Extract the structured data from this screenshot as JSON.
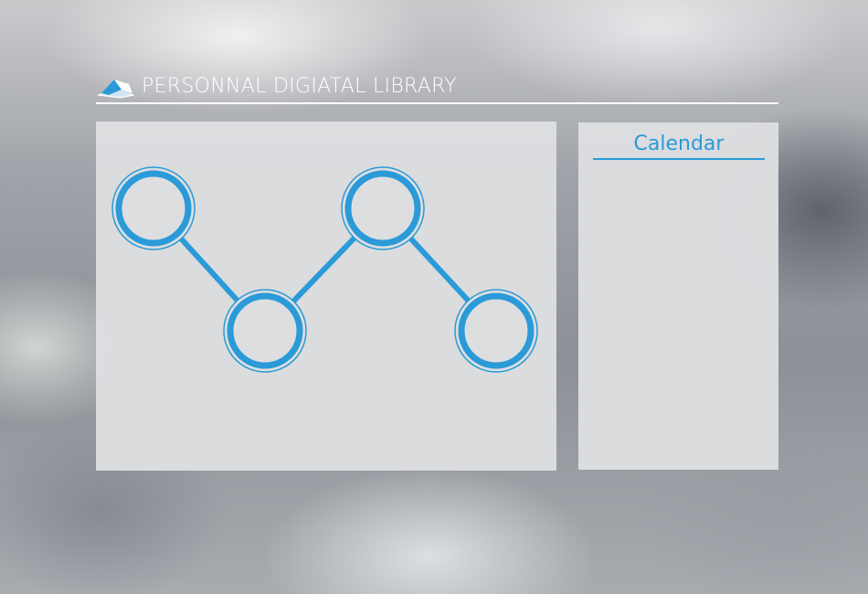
{
  "header": {
    "title": "PERSONNAL DIGIATAL LIBRARY",
    "logo_icon": "open-book-icon"
  },
  "calendar": {
    "title": "Calendar"
  },
  "theme": {
    "accent": "#2a9ad8",
    "panel": "#dddee0",
    "header_text": "#ffffff"
  },
  "graph": {
    "nodes": 4,
    "edges": 3
  }
}
